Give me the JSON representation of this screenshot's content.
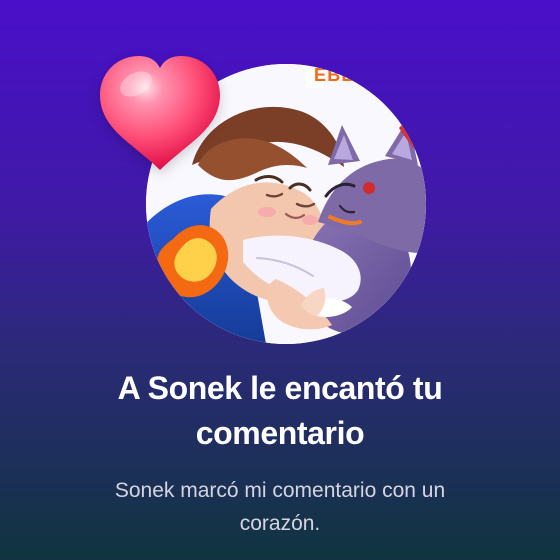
{
  "notification": {
    "title_lines": [
      "A Sonek le encantó tu",
      "comentario"
    ],
    "subtitle_lines": [
      "Sonek marcó mi comentario con un",
      "corazón."
    ]
  },
  "avatar": {
    "image_text": "EBLA"
  },
  "icons": {
    "heart": "heart-icon"
  },
  "colors": {
    "gradient_top": "#4a0fc9",
    "gradient_bottom": "#10343f",
    "heart": "#ff4f78",
    "subtitle": "#d6d4e2"
  }
}
